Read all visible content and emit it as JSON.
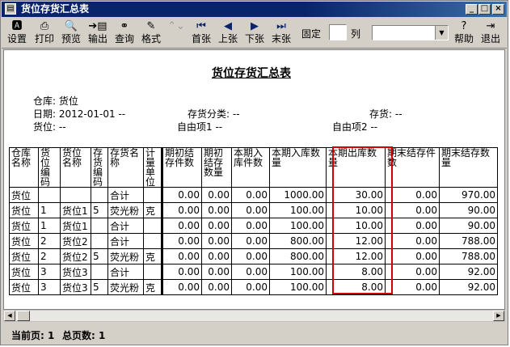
{
  "window": {
    "title": "货位存货汇总表"
  },
  "toolbar": {
    "buttons": [
      {
        "label": "设置",
        "icon": "settings-icon"
      },
      {
        "label": "打印",
        "icon": "printer-icon"
      },
      {
        "label": "预览",
        "icon": "preview-icon"
      },
      {
        "label": "输出",
        "icon": "export-icon"
      },
      {
        "label": "查询",
        "icon": "binoculars-icon"
      },
      {
        "label": "格式",
        "icon": "format-icon"
      },
      {
        "label": "",
        "icon": "up-down-icon"
      },
      {
        "label": "首张",
        "icon": "first-page-icon"
      },
      {
        "label": "上张",
        "icon": "prev-page-icon"
      },
      {
        "label": "下张",
        "icon": "next-page-icon"
      },
      {
        "label": "末张",
        "icon": "last-page-icon"
      },
      {
        "label": "帮助",
        "icon": "help-icon"
      },
      {
        "label": "退出",
        "icon": "exit-icon"
      }
    ],
    "fixed_label": "固定",
    "column_label": "列",
    "fixed_value": ""
  },
  "report": {
    "title": "货位存货汇总表",
    "warehouse_label": "仓库: 货位",
    "date_label": "日期: 2012-01-01 --",
    "category_label": "存货分类: --",
    "inventory_label": "存货: --",
    "location_label": "货位: --",
    "free1_label": "自由项1  --",
    "free2_label": "自由项2  --",
    "columns": [
      "仓库名称",
      "货位编码",
      "货位名称",
      "存货编码",
      "存货名称",
      "计量单位",
      "期初结存件数",
      "期初结存数量",
      "本期入库件数",
      "本期入库数量",
      "本期出库数量",
      "期末结存件数",
      "期末结存数量"
    ],
    "rows": [
      [
        "货位",
        "",
        "",
        "",
        "合计",
        "",
        "0.00",
        "0.00",
        "0.00",
        "1000.00",
        "30.00",
        "0.00",
        "970.00"
      ],
      [
        "货位",
        "1",
        "货位1",
        "5",
        "荧光粉",
        "克",
        "0.00",
        "0.00",
        "0.00",
        "100.00",
        "10.00",
        "0.00",
        "90.00"
      ],
      [
        "货位",
        "1",
        "货位1",
        "",
        "合计",
        "",
        "0.00",
        "0.00",
        "0.00",
        "100.00",
        "10.00",
        "0.00",
        "90.00"
      ],
      [
        "货位",
        "2",
        "货位2",
        "",
        "合计",
        "",
        "0.00",
        "0.00",
        "0.00",
        "800.00",
        "12.00",
        "0.00",
        "788.00"
      ],
      [
        "货位",
        "2",
        "货位2",
        "5",
        "荧光粉",
        "克",
        "0.00",
        "0.00",
        "0.00",
        "800.00",
        "12.00",
        "0.00",
        "788.00"
      ],
      [
        "货位",
        "3",
        "货位3",
        "",
        "合计",
        "",
        "0.00",
        "0.00",
        "0.00",
        "100.00",
        "8.00",
        "0.00",
        "92.00"
      ],
      [
        "货位",
        "3",
        "货位3",
        "5",
        "荧光粉",
        "克",
        "0.00",
        "0.00",
        "0.00",
        "100.00",
        "8.00",
        "0.00",
        "92.00"
      ]
    ]
  },
  "status": {
    "current_page": "当前页: 1",
    "total_pages": "总页数: 1"
  },
  "colors": {
    "titlebar": "#0a246a",
    "highlight_box": "#d00000",
    "chrome": "#d4d0c8"
  }
}
